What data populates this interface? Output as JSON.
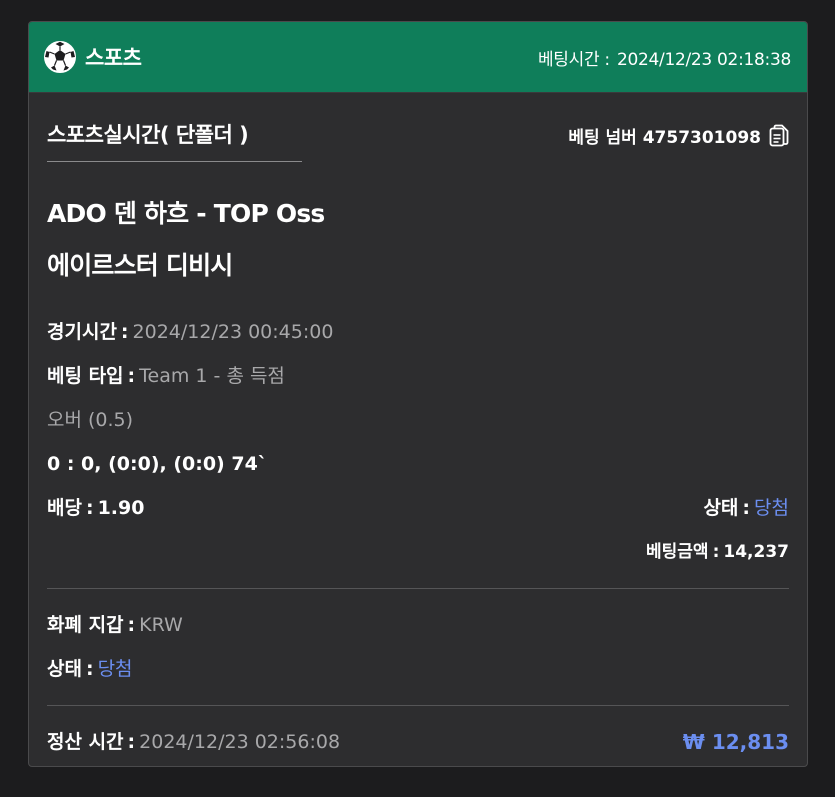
{
  "header": {
    "sport": "스포츠",
    "bet_time_label": "베팅시간 :",
    "bet_time_value": "2024/12/23 02:18:38"
  },
  "market": "스포츠실시간( 단폴더 )",
  "bet_number": "베팅 넘버 4757301098",
  "teams": {
    "match": "ADO 덴 하흐 - TOP Oss",
    "selection": "에이르스터 디비시"
  },
  "details": {
    "match_time_label": "경기시간",
    "match_time_value": "2024/12/23 00:45:00",
    "bet_type_label": "베팅 타입",
    "bet_type_value": "Team 1 - 총 득점",
    "pick": "오버 (0.5)",
    "score": "0 : 0, (0:0), (0:0) 74`",
    "odds_label": "배당",
    "odds_value": "1.90",
    "status_label": "상태",
    "status_value": "당첨",
    "stake_label": "베팅금액",
    "stake_value": "14,237"
  },
  "wallet": {
    "currency_label": "화폐 지갑",
    "currency_value": "KRW",
    "status_label": "상태",
    "status_value": "당첨"
  },
  "settlement": {
    "label": "정산 시간",
    "value": "2024/12/23 02:56:08",
    "amount": "₩ 12,813"
  },
  "colors": {
    "header_bg": "#0f7e5a",
    "card_bg": "#2d2d2f",
    "accent_blue": "#6b8ef0",
    "muted_text": "#a8a8aa"
  },
  "icons": [
    "soccer-ball-icon",
    "document-copy-icon"
  ]
}
